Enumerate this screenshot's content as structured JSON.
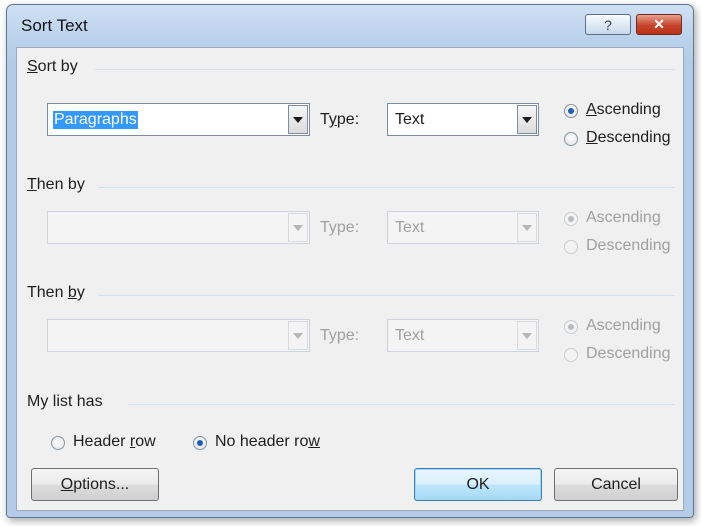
{
  "window": {
    "title": "Sort Text",
    "help_label": "?",
    "close_label": "✕"
  },
  "sort_by": {
    "label_prefix": "",
    "label_key": "S",
    "label_rest": "ort by",
    "field_value": "Paragraphs",
    "type_label_pre": "T",
    "type_label_key": "y",
    "type_label_post": "pe:",
    "type_value": "Text",
    "ascending_key": "A",
    "ascending_rest": "scending",
    "descending_key": "D",
    "descending_rest": "escending",
    "selected": "Ascending"
  },
  "then_by_1": {
    "label_key": "T",
    "label_rest": "hen by",
    "field_value": "",
    "type_label": "Type:",
    "type_value": "Text",
    "ascending": "Ascending",
    "descending": "Descending",
    "selected": "Ascending",
    "enabled": false
  },
  "then_by_2": {
    "label_pre": "Then ",
    "label_key": "b",
    "label_post": "y",
    "field_value": "",
    "type_label": "Type:",
    "type_value": "Text",
    "ascending": "Ascending",
    "descending": "Descending",
    "selected": "Ascending",
    "enabled": false
  },
  "list_has": {
    "label": "My list has",
    "header_row_pre": "Header ",
    "header_row_key": "r",
    "header_row_post": "ow",
    "no_header_row_pre": "No header ro",
    "no_header_row_key": "w",
    "no_header_row_post": "",
    "selected": "No header row"
  },
  "buttons": {
    "options_key": "O",
    "options_rest": "ptions...",
    "ok": "OK",
    "cancel": "Cancel"
  },
  "colors": {
    "accent": "#1f5db8",
    "selection": "#3399ff",
    "close": "#c7442b"
  }
}
